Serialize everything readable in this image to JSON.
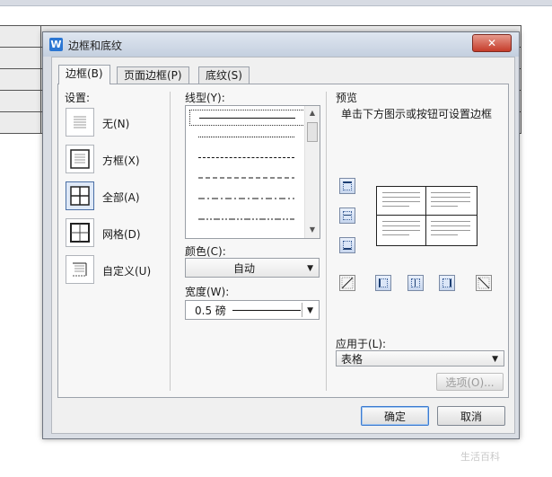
{
  "dialog": {
    "title": "边框和底纹",
    "app_icon_letter": "W",
    "close_glyph": "✕"
  },
  "tabs": [
    {
      "label": "边框(B)",
      "active": true
    },
    {
      "label": "页面边框(P)",
      "active": false
    },
    {
      "label": "底纹(S)",
      "active": false
    }
  ],
  "settings": {
    "label": "设置:",
    "items": [
      {
        "label": "无(N)",
        "icon": "none-border-icon"
      },
      {
        "label": "方框(X)",
        "icon": "box-border-icon"
      },
      {
        "label": "全部(A)",
        "icon": "all-borders-icon",
        "selected": true
      },
      {
        "label": "网格(D)",
        "icon": "grid-border-icon"
      },
      {
        "label": "自定义(U)",
        "icon": "custom-border-icon"
      }
    ]
  },
  "line_style": {
    "label": "线型(Y):",
    "options": [
      "solid",
      "dotted",
      "dashed-short",
      "dashed",
      "dash-dot",
      "dash-dot-dot"
    ],
    "selected": "solid"
  },
  "color": {
    "label": "颜色(C):",
    "value": "自动"
  },
  "width": {
    "label": "宽度(W):",
    "value": "0.5 磅"
  },
  "preview": {
    "label": "预览",
    "hint": "单击下方图示或按钮可设置边框"
  },
  "apply_to": {
    "label": "应用于(L):",
    "value": "表格"
  },
  "buttons": {
    "options": "选项(O)...",
    "ok": "确定",
    "cancel": "取消"
  },
  "watermark": "生活百科"
}
